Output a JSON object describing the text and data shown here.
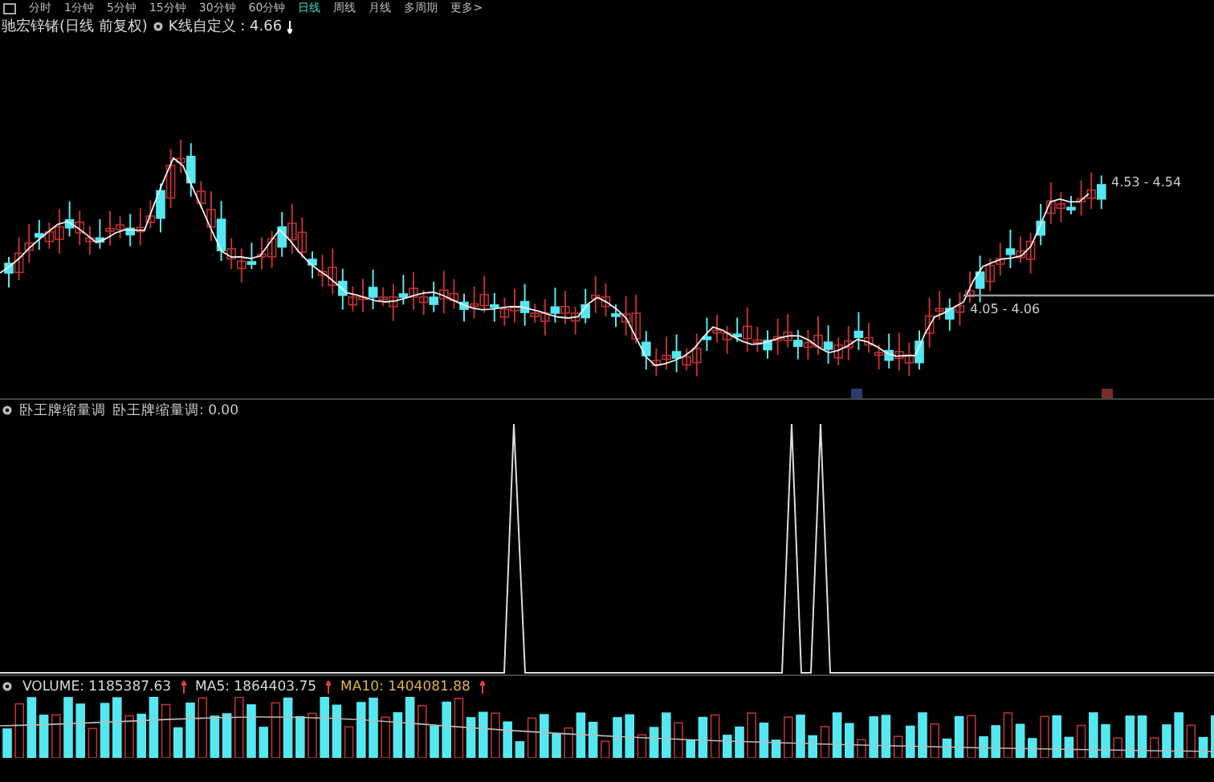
{
  "toolbar": {
    "tabs": [
      {
        "label": "分时",
        "selected": false
      },
      {
        "label": "1分钟",
        "selected": false
      },
      {
        "label": "5分钟",
        "selected": false
      },
      {
        "label": "15分钟",
        "selected": false
      },
      {
        "label": "30分钟",
        "selected": false
      },
      {
        "label": "60分钟",
        "selected": false
      },
      {
        "label": "日线",
        "selected": true
      },
      {
        "label": "周线",
        "selected": false
      },
      {
        "label": "月线",
        "selected": false
      },
      {
        "label": "多周期",
        "selected": false
      },
      {
        "label": "更多>",
        "selected": false
      }
    ]
  },
  "price_panel": {
    "title": "驰宏锌锗(日线 前复权)",
    "indicator": "K线自定义 : 4.66",
    "high_label": "4.53 - 4.54",
    "low_label": "4.05 - 4.06"
  },
  "indicator_panel": {
    "name": "卧王牌缩量调",
    "reading": "卧王牌缩量调: 0.00"
  },
  "volume_panel": {
    "readings": [
      {
        "text": "VOLUME: 1185387.63",
        "color": "#d8d8d8"
      },
      {
        "text": "MA5: 1864403.75",
        "color": "#d8d8d8"
      },
      {
        "text": "MA10: 1404081.88",
        "color": "#e0b050"
      }
    ]
  }
}
